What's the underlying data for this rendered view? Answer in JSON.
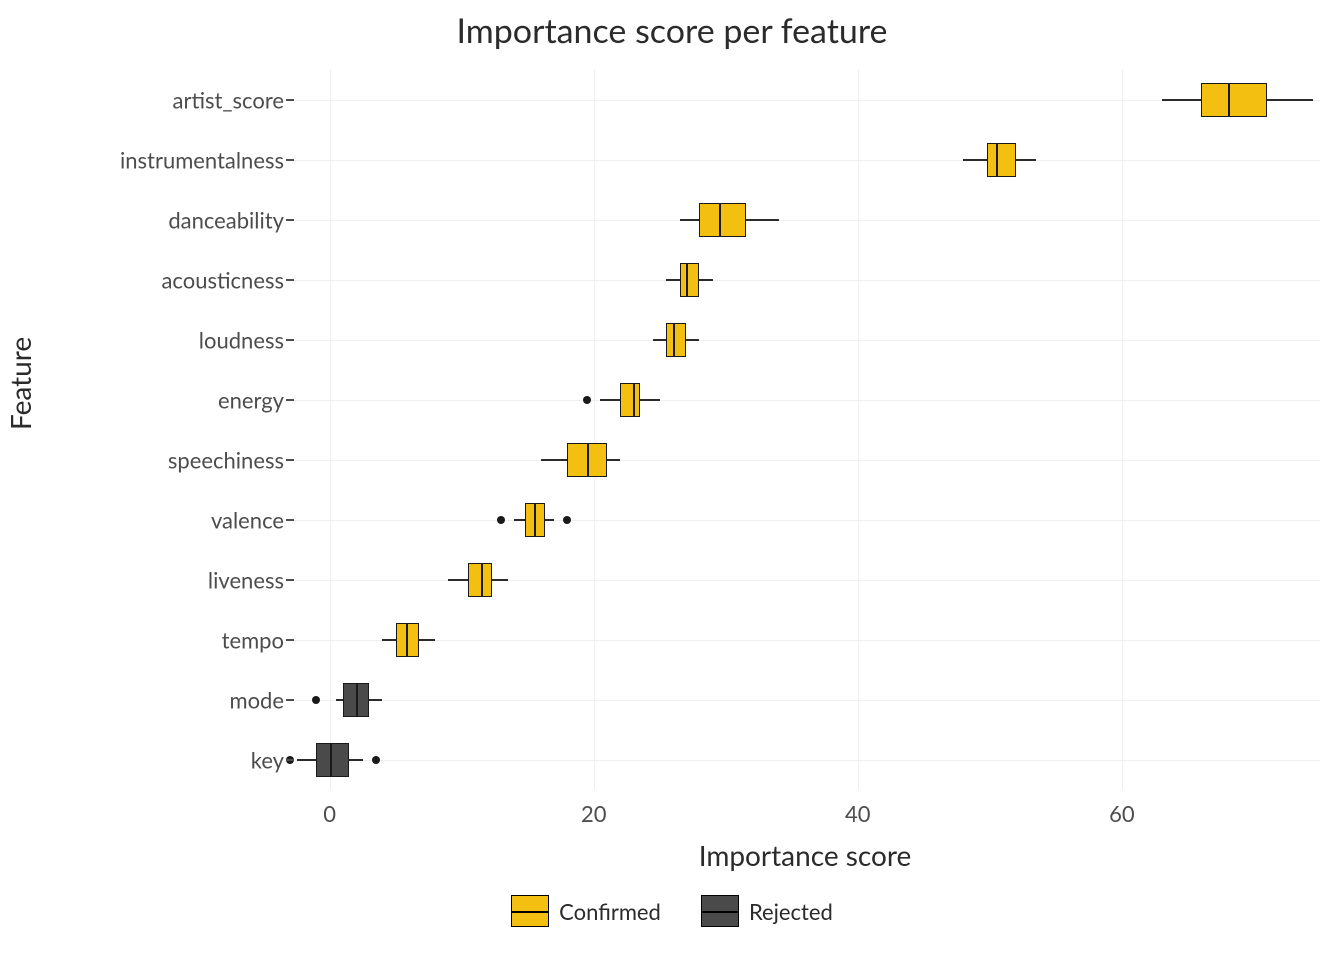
{
  "chart_data": {
    "type": "boxplot-horizontal",
    "title": "Importance score per feature",
    "xlabel": "Importance score",
    "ylabel": "Feature",
    "xlim": [
      -3,
      75
    ],
    "x_ticks": [
      0,
      20,
      40,
      60
    ],
    "legend": {
      "position": "bottom",
      "entries": [
        {
          "name": "Confirmed",
          "color": "#f3c011"
        },
        {
          "name": "Rejected",
          "color": "#4a4a4a"
        }
      ]
    },
    "series": [
      {
        "feature": "artist_score",
        "group": "Confirmed",
        "min": 63.0,
        "q1": 66.0,
        "median": 68.0,
        "q3": 71.0,
        "max": 74.5,
        "outliers": []
      },
      {
        "feature": "instrumentalness",
        "group": "Confirmed",
        "min": 48.0,
        "q1": 49.8,
        "median": 50.5,
        "q3": 52.0,
        "max": 53.5,
        "outliers": []
      },
      {
        "feature": "danceability",
        "group": "Confirmed",
        "min": 26.5,
        "q1": 28.0,
        "median": 29.5,
        "q3": 31.5,
        "max": 34.0,
        "outliers": []
      },
      {
        "feature": "acousticness",
        "group": "Confirmed",
        "min": 25.5,
        "q1": 26.5,
        "median": 27.0,
        "q3": 28.0,
        "max": 29.0,
        "outliers": []
      },
      {
        "feature": "loudness",
        "group": "Confirmed",
        "min": 24.5,
        "q1": 25.5,
        "median": 26.0,
        "q3": 27.0,
        "max": 28.0,
        "outliers": []
      },
      {
        "feature": "energy",
        "group": "Confirmed",
        "min": 20.5,
        "q1": 22.0,
        "median": 23.0,
        "q3": 23.5,
        "max": 25.0,
        "outliers": [
          19.5
        ]
      },
      {
        "feature": "speechiness",
        "group": "Confirmed",
        "min": 16.0,
        "q1": 18.0,
        "median": 19.5,
        "q3": 21.0,
        "max": 22.0,
        "outliers": []
      },
      {
        "feature": "valence",
        "group": "Confirmed",
        "min": 14.0,
        "q1": 14.8,
        "median": 15.5,
        "q3": 16.3,
        "max": 17.0,
        "outliers": [
          13.0,
          18.0
        ]
      },
      {
        "feature": "liveness",
        "group": "Confirmed",
        "min": 9.0,
        "q1": 10.5,
        "median": 11.5,
        "q3": 12.3,
        "max": 13.5,
        "outliers": []
      },
      {
        "feature": "tempo",
        "group": "Confirmed",
        "min": 4.0,
        "q1": 5.0,
        "median": 5.8,
        "q3": 6.8,
        "max": 8.0,
        "outliers": []
      },
      {
        "feature": "mode",
        "group": "Rejected",
        "min": 0.5,
        "q1": 1.0,
        "median": 2.0,
        "q3": 3.0,
        "max": 4.0,
        "outliers": [
          -1.0
        ]
      },
      {
        "feature": "key",
        "group": "Rejected",
        "min": -2.5,
        "q1": -1.0,
        "median": 0.0,
        "q3": 1.5,
        "max": 2.5,
        "outliers": [
          -3.0,
          3.5
        ]
      }
    ]
  }
}
